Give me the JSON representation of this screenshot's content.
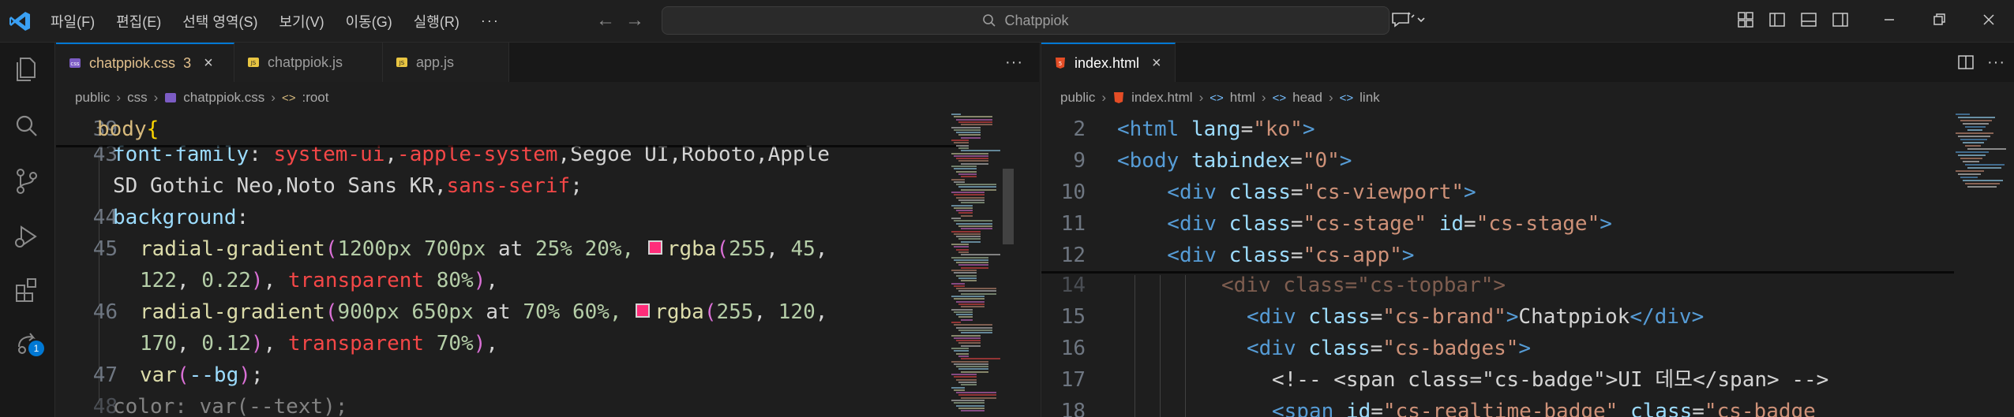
{
  "menu": [
    "파일(F)",
    "편집(E)",
    "선택 영역(S)",
    "보기(V)",
    "이동(G)",
    "실행(R)",
    "···"
  ],
  "search": {
    "text": "Chatppiok"
  },
  "activity_badge": "1",
  "left": {
    "tabs": [
      {
        "label": "chatppiok.css",
        "modified": "3",
        "icon": "css-file-icon"
      },
      {
        "label": "chatppiok.js",
        "icon": "js-file-icon"
      },
      {
        "label": "app.js",
        "icon": "js-file-icon"
      }
    ],
    "breadcrumb": [
      "public",
      "css",
      "chatppiok.css",
      ":root"
    ],
    "sticky": {
      "ln": "39",
      "text": "body{"
    },
    "lines": [
      {
        "ln": "43",
        "parts": [
          [
            "font-family",
            "prop"
          ],
          [
            ": ",
            "plain"
          ],
          [
            "system-ui",
            "kw"
          ],
          [
            ",",
            "plain"
          ],
          [
            "-apple-system",
            "kw"
          ],
          [
            ",Segoe UI,Roboto,Apple",
            "plain"
          ]
        ]
      },
      {
        "ln": "",
        "parts": [
          [
            "SD Gothic Neo,Noto Sans KR,",
            "plain"
          ],
          [
            "sans-serif",
            "kw"
          ],
          [
            ";",
            "plain"
          ]
        ]
      },
      {
        "ln": "44",
        "parts": [
          [
            "background",
            "prop"
          ],
          [
            ":",
            "plain"
          ]
        ]
      },
      {
        "ln": "45",
        "parts": [
          [
            "radial-gradient",
            "fn"
          ],
          [
            "(",
            "paren"
          ],
          [
            "1200",
            "num"
          ],
          [
            "px ",
            "unit"
          ],
          [
            "700",
            "num"
          ],
          [
            "px ",
            "unit"
          ],
          [
            "at ",
            "plain"
          ],
          [
            "25",
            "num"
          ],
          [
            "% ",
            "unit"
          ],
          [
            "20",
            "num"
          ],
          [
            "%, ",
            "unit"
          ],
          [
            "SWATCH",
            "swatch"
          ],
          [
            "rgba",
            "fn"
          ],
          [
            "(",
            "paren"
          ],
          [
            "255",
            "num"
          ],
          [
            ", ",
            "plain"
          ],
          [
            "45",
            "num"
          ],
          [
            ",",
            "plain"
          ]
        ]
      },
      {
        "ln": "",
        "parts": [
          [
            "122",
            "num"
          ],
          [
            ", ",
            "plain"
          ],
          [
            "0.22",
            "num"
          ],
          [
            ")",
            "paren"
          ],
          [
            ", ",
            "plain"
          ],
          [
            "transparent",
            "kw"
          ],
          [
            " ",
            "plain"
          ],
          [
            "80",
            "num"
          ],
          [
            "%",
            "unit"
          ],
          [
            ")",
            "paren"
          ],
          [
            ",",
            "plain"
          ]
        ]
      },
      {
        "ln": "46",
        "parts": [
          [
            "radial-gradient",
            "fn"
          ],
          [
            "(",
            "paren"
          ],
          [
            "900",
            "num"
          ],
          [
            "px ",
            "unit"
          ],
          [
            "650",
            "num"
          ],
          [
            "px ",
            "unit"
          ],
          [
            "at ",
            "plain"
          ],
          [
            "70",
            "num"
          ],
          [
            "% ",
            "unit"
          ],
          [
            "60",
            "num"
          ],
          [
            "%, ",
            "unit"
          ],
          [
            "SWATCH",
            "swatch"
          ],
          [
            "rgba",
            "fn"
          ],
          [
            "(",
            "paren"
          ],
          [
            "255",
            "num"
          ],
          [
            ", ",
            "plain"
          ],
          [
            "120",
            "num"
          ],
          [
            ",",
            "plain"
          ]
        ]
      },
      {
        "ln": "",
        "parts": [
          [
            "170",
            "num"
          ],
          [
            ", ",
            "plain"
          ],
          [
            "0.12",
            "num"
          ],
          [
            ")",
            "paren"
          ],
          [
            ", ",
            "plain"
          ],
          [
            "transparent",
            "kw"
          ],
          [
            " ",
            "plain"
          ],
          [
            "70",
            "num"
          ],
          [
            "%",
            "unit"
          ],
          [
            ")",
            "paren"
          ],
          [
            ",",
            "plain"
          ]
        ]
      },
      {
        "ln": "47",
        "parts": [
          [
            "var",
            "fn"
          ],
          [
            "(",
            "paren"
          ],
          [
            "--bg",
            "var"
          ],
          [
            ")",
            "paren"
          ],
          [
            ";",
            "plain"
          ]
        ]
      },
      {
        "ln": "48",
        "parts": [
          [
            "color: var(--text);",
            "plain"
          ]
        ]
      }
    ]
  },
  "right": {
    "tabs": [
      {
        "label": "index.html",
        "icon": "html-file-icon"
      }
    ],
    "breadcrumb": [
      "public",
      "index.html",
      "html",
      "head",
      "link"
    ],
    "sticky": [
      {
        "ln": "2",
        "parts": [
          [
            "<",
            "tag"
          ],
          [
            "html",
            "tag"
          ],
          [
            " ",
            "plain"
          ],
          [
            "lang",
            "attr"
          ],
          [
            "=",
            "plain"
          ],
          [
            "\"ko\"",
            "str"
          ],
          [
            ">",
            "tag"
          ]
        ]
      },
      {
        "ln": "9",
        "parts": [
          [
            "<",
            "tag"
          ],
          [
            "body",
            "tag"
          ],
          [
            " ",
            "plain"
          ],
          [
            "tabindex",
            "attr"
          ],
          [
            "=",
            "plain"
          ],
          [
            "\"0\"",
            "str"
          ],
          [
            ">",
            "tag"
          ]
        ]
      },
      {
        "ln": "10",
        "parts": [
          [
            "  <",
            "tag"
          ],
          [
            "div",
            "tag"
          ],
          [
            " ",
            "plain"
          ],
          [
            "class",
            "attr"
          ],
          [
            "=",
            "plain"
          ],
          [
            "\"cs-viewport\"",
            "str"
          ],
          [
            ">",
            "tag"
          ]
        ]
      },
      {
        "ln": "11",
        "parts": [
          [
            "  <",
            "tag"
          ],
          [
            "div",
            "tag"
          ],
          [
            " ",
            "plain"
          ],
          [
            "class",
            "attr"
          ],
          [
            "=",
            "plain"
          ],
          [
            "\"cs-stage\"",
            "str"
          ],
          [
            " ",
            "plain"
          ],
          [
            "id",
            "attr"
          ],
          [
            "=",
            "plain"
          ],
          [
            "\"cs-stage\"",
            "str"
          ],
          [
            ">",
            "tag"
          ]
        ]
      },
      {
        "ln": "12",
        "parts": [
          [
            "  <",
            "tag"
          ],
          [
            "div",
            "tag"
          ],
          [
            " ",
            "plain"
          ],
          [
            "class",
            "attr"
          ],
          [
            "=",
            "plain"
          ],
          [
            "\"cs-app\"",
            "str"
          ],
          [
            ">",
            "tag"
          ]
        ]
      }
    ],
    "lines": [
      {
        "ln": "14",
        "parts": [
          [
            "<div class=\"cs-topbar\">",
            "str"
          ]
        ]
      },
      {
        "ln": "15",
        "parts": [
          [
            "<",
            "tag"
          ],
          [
            "div",
            "tag"
          ],
          [
            " ",
            "plain"
          ],
          [
            "class",
            "attr"
          ],
          [
            "=",
            "plain"
          ],
          [
            "\"cs-brand\"",
            "str"
          ],
          [
            ">",
            "tag"
          ],
          [
            "Chatppiok",
            "text"
          ],
          [
            "</",
            "tag"
          ],
          [
            "div",
            "tag"
          ],
          [
            ">",
            "tag"
          ]
        ]
      },
      {
        "ln": "16",
        "parts": [
          [
            "<",
            "tag"
          ],
          [
            "div",
            "tag"
          ],
          [
            " ",
            "plain"
          ],
          [
            "class",
            "attr"
          ],
          [
            "=",
            "plain"
          ],
          [
            "\"cs-badges\"",
            "str"
          ],
          [
            ">",
            "tag"
          ]
        ]
      },
      {
        "ln": "17",
        "parts": [
          [
            "<!-- <span class=\"cs-badge\">UI 데모</span> -->",
            "text"
          ]
        ]
      },
      {
        "ln": "18",
        "parts": [
          [
            "<",
            "tag"
          ],
          [
            "span",
            "tag"
          ],
          [
            " ",
            "plain"
          ],
          [
            "id",
            "attr"
          ],
          [
            "=",
            "plain"
          ],
          [
            "\"cs-realtime-badge\"",
            "str"
          ],
          [
            " ",
            "plain"
          ],
          [
            "class",
            "attr"
          ],
          [
            "=",
            "plain"
          ],
          [
            "\"cs-badge",
            "str"
          ]
        ]
      }
    ]
  },
  "colors": {
    "accent": "#0078d4",
    "swatch1": "#ff2d7a",
    "swatch2": "#ff78aa"
  }
}
